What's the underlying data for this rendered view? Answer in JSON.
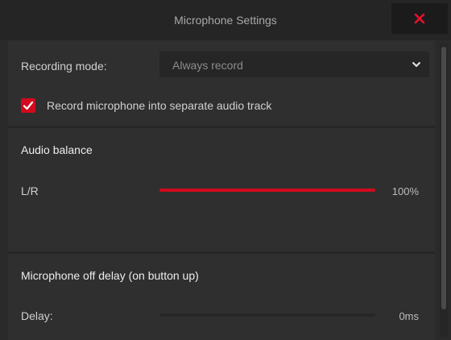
{
  "window": {
    "title": "Microphone Settings"
  },
  "recording": {
    "label": "Recording mode:",
    "selected": "Always record"
  },
  "separate_track": {
    "label": "Record microphone into separate audio track",
    "checked": true
  },
  "audio_balance": {
    "title": "Audio balance",
    "slider_label": "L/R",
    "value_text": "100%",
    "level_percent": 100
  },
  "mic_off_delay": {
    "title": "Microphone off delay (on button up)",
    "slider_label": "Delay:",
    "value_text": "0ms",
    "level_percent": 0
  },
  "colors": {
    "accent": "#d10a1e",
    "background": "#2f2f2f",
    "titlebar": "#252525"
  },
  "icons": {
    "close": "close-icon",
    "dropdown": "chevron-down-icon",
    "check": "checkmark-icon"
  }
}
